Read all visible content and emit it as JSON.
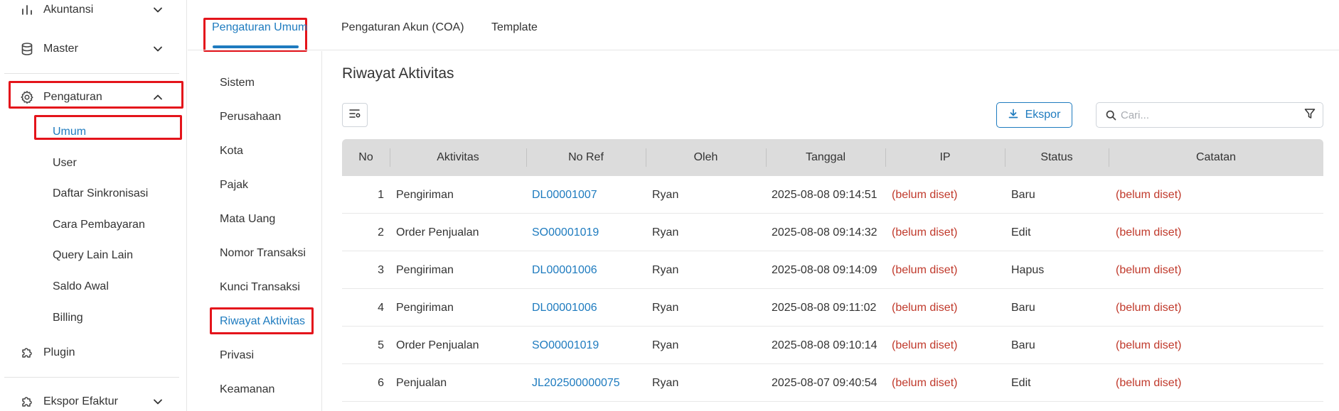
{
  "sidebar": {
    "main_items": [
      {
        "label": "Akuntansi",
        "icon": "bar-chart-icon",
        "expanded": false
      },
      {
        "label": "Master",
        "icon": "database-icon",
        "expanded": false
      },
      {
        "label": "Pengaturan",
        "icon": "gear-icon",
        "expanded": true
      },
      {
        "label": "Plugin",
        "icon": "puzzle-icon"
      },
      {
        "label": "Ekspor Efaktur",
        "icon": "puzzle-icon",
        "expanded": false
      }
    ],
    "sub_items": [
      {
        "label": "Umum",
        "active": true
      },
      {
        "label": "User"
      },
      {
        "label": "Daftar Sinkronisasi"
      },
      {
        "label": "Cara Pembayaran"
      },
      {
        "label": "Query Lain Lain"
      },
      {
        "label": "Saldo Awal"
      },
      {
        "label": "Billing"
      }
    ]
  },
  "tabs": [
    {
      "label": "Pengaturan Umum",
      "active": true
    },
    {
      "label": "Pengaturan Akun (COA)"
    },
    {
      "label": "Template"
    }
  ],
  "submenu": [
    {
      "label": "Sistem"
    },
    {
      "label": "Perusahaan"
    },
    {
      "label": "Kota"
    },
    {
      "label": "Pajak"
    },
    {
      "label": "Mata Uang"
    },
    {
      "label": "Nomor Transaksi"
    },
    {
      "label": "Kunci Transaksi"
    },
    {
      "label": "Riwayat Aktivitas",
      "active": true
    },
    {
      "label": "Privasi"
    },
    {
      "label": "Keamanan"
    }
  ],
  "content": {
    "title": "Riwayat Aktivitas",
    "export_label": "Ekspor",
    "search_placeholder": "Cari..."
  },
  "table": {
    "headers": [
      "No",
      "Aktivitas",
      "No Ref",
      "Oleh",
      "Tanggal",
      "IP",
      "Status",
      "Catatan"
    ],
    "rows": [
      {
        "no": "1",
        "aktivitas": "Pengiriman",
        "ref": "DL00001007",
        "oleh": "Ryan",
        "tanggal": "2025-08-08 09:14:51",
        "ip": "(belum diset)",
        "status": "Baru",
        "catatan": "(belum diset)"
      },
      {
        "no": "2",
        "aktivitas": "Order Penjualan",
        "ref": "SO00001019",
        "oleh": "Ryan",
        "tanggal": "2025-08-08 09:14:32",
        "ip": "(belum diset)",
        "status": "Edit",
        "catatan": "(belum diset)"
      },
      {
        "no": "3",
        "aktivitas": "Pengiriman",
        "ref": "DL00001006",
        "oleh": "Ryan",
        "tanggal": "2025-08-08 09:14:09",
        "ip": "(belum diset)",
        "status": "Hapus",
        "catatan": "(belum diset)"
      },
      {
        "no": "4",
        "aktivitas": "Pengiriman",
        "ref": "DL00001006",
        "oleh": "Ryan",
        "tanggal": "2025-08-08 09:11:02",
        "ip": "(belum diset)",
        "status": "Baru",
        "catatan": "(belum diset)"
      },
      {
        "no": "5",
        "aktivitas": "Order Penjualan",
        "ref": "SO00001019",
        "oleh": "Ryan",
        "tanggal": "2025-08-08 09:10:14",
        "ip": "(belum diset)",
        "status": "Baru",
        "catatan": "(belum diset)"
      },
      {
        "no": "6",
        "aktivitas": "Penjualan",
        "ref": "JL202500000075",
        "oleh": "Ryan",
        "tanggal": "2025-08-07 09:40:54",
        "ip": "(belum diset)",
        "status": "Edit",
        "catatan": "(belum diset)"
      }
    ]
  },
  "colors": {
    "accent": "#1e7bbf",
    "highlight_box": "#e4141b",
    "unset_text": "#c0392b",
    "table_header_bg": "#dcdcdc"
  }
}
